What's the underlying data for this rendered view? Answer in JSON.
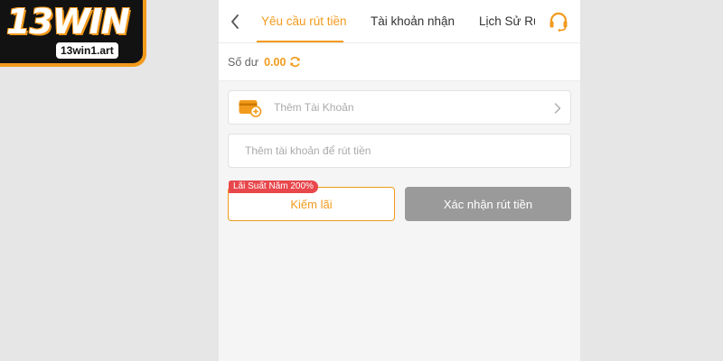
{
  "logo": {
    "wordmark": "13WIN",
    "url_badge": "13win1.art",
    "colors": {
      "accent": "#f29a1c",
      "background": "#121212"
    }
  },
  "header": {
    "back_icon": "chevron-left-icon",
    "tabs": [
      {
        "label": "Yêu cầu rút tiền",
        "active": true
      },
      {
        "label": "Tài khoản nhận",
        "active": false
      },
      {
        "label": "Lịch Sử Rú",
        "active": false
      }
    ],
    "support_icon": "headset-icon"
  },
  "balance": {
    "label": "Số dư",
    "value": "0.00",
    "refresh_icon": "refresh-icon"
  },
  "add_account": {
    "label": "Thêm Tài Khoản",
    "icon": "wallet-add-icon",
    "chevron_icon": "chevron-right-icon"
  },
  "account_field": {
    "placeholder": "Thêm tài khoản để rút tiền",
    "value": ""
  },
  "actions": {
    "interest_badge": "Lãi Suất Năm 200%",
    "earn_label": "Kiếm lãi",
    "confirm_label": "Xác nhận rút tiền"
  },
  "colors": {
    "accent": "#f29a1c",
    "badge": "#e8474c",
    "disabled_button": "#9a9a9a",
    "page_background": "#f5f5f5"
  }
}
